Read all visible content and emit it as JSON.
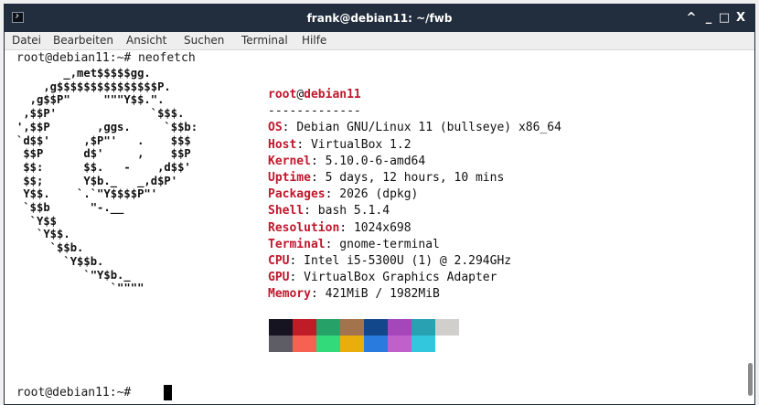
{
  "window": {
    "title": "frank@debian11: ~/fwb",
    "controls": [
      "^",
      "_",
      "□",
      "X"
    ]
  },
  "menu": [
    "Datei",
    "Bearbeiten",
    "Ansicht",
    "Suchen",
    "Terminal",
    "Hilfe"
  ],
  "terminal": {
    "command_line": "root@debian11:~# neofetch",
    "logo_ascii": "       _,met$$$$$gg.\n    ,g$$$$$$$$$$$$$$$P.\n  ,g$$P\"     \"\"\"Y$$.\".\n ,$$P'              `$$$.\n',$$P       ,ggs.     `$$b:\n`d$$'     ,$P\"'   .    $$$\n $$P      d$'     ,    $$P\n $$:      $$.   -    ,d$$'\n $$;      Y$b._   _,d$P'\n Y$$.    `.`\"Y$$$$P\"'\n `$$b      \"-.__\n  `Y$$\n   `Y$$.\n     `$$b.\n       `Y$$b.\n          `\"Y$b._\n              `\"\"\"\"",
    "header": {
      "user": "root",
      "at": "@",
      "host": "debian11"
    },
    "separator": "-------------",
    "info": [
      {
        "key": "OS",
        "value": "Debian GNU/Linux 11 (bullseye) x86_64"
      },
      {
        "key": "Host",
        "value": "VirtualBox 1.2"
      },
      {
        "key": "Kernel",
        "value": "5.10.0-6-amd64"
      },
      {
        "key": "Uptime",
        "value": "5 days, 12 hours, 10 mins"
      },
      {
        "key": "Packages",
        "value": "2026 (dpkg)"
      },
      {
        "key": "Shell",
        "value": "bash 5.1.4"
      },
      {
        "key": "Resolution",
        "value": "1024x698"
      },
      {
        "key": "Terminal",
        "value": "gnome-terminal"
      },
      {
        "key": "CPU",
        "value": "Intel i5-5300U (1) @ 2.294GHz"
      },
      {
        "key": "GPU",
        "value": "VirtualBox Graphics Adapter"
      },
      {
        "key": "Memory",
        "value": "421MiB / 1982MiB"
      }
    ],
    "palette": {
      "normal": [
        "#171421",
        "#c01c28",
        "#26a269",
        "#a2734c",
        "#12488b",
        "#a347ba",
        "#2aa1b3",
        "#d0cfcc"
      ],
      "bright": [
        "#5e5c64",
        "#f66151",
        "#33da7a",
        "#e9ad0c",
        "#2a7bde",
        "#c061cb",
        "#33c7de",
        "#ffffff"
      ]
    },
    "prompt": "root@debian11:~# "
  },
  "colors": {
    "titlebar_bg": "#222e3e",
    "key_color": "#c0172c",
    "menubar_bg": "#eeeeee"
  }
}
